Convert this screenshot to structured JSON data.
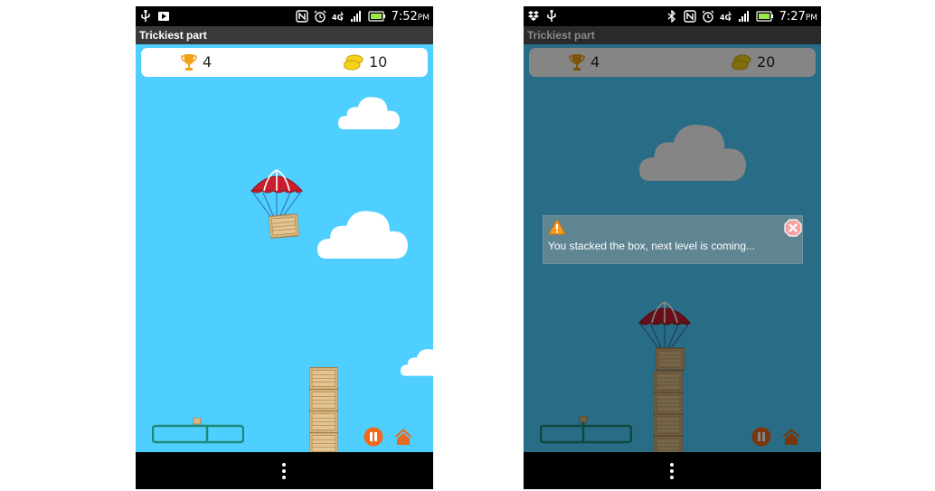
{
  "app": {
    "title": "Trickiest part"
  },
  "colors": {
    "sky": "#4fcfff",
    "cloud": "#ffffff",
    "parachute": "#c81e2e",
    "crate": "#d8b884",
    "hud_bg": "#ffffff",
    "pause_btn": "#f06a1a",
    "home_btn": "#e56a21",
    "slider": "#1d8a76",
    "dialog_bg": "#5f8492",
    "warning": "#f59a1a"
  },
  "screens": [
    {
      "status": {
        "time": "7:52",
        "ampm": "PM"
      },
      "hud": {
        "score": "4",
        "coins": "10"
      },
      "stack_count": 4,
      "game_state": "dropping"
    },
    {
      "status": {
        "time": "7:27",
        "ampm": "PM"
      },
      "hud": {
        "score": "4",
        "coins": "20"
      },
      "stack_count": 5,
      "game_state": "level-complete",
      "dialog": {
        "message": "You stacked the box, next level is coming..."
      }
    }
  ],
  "icons": {
    "hud": [
      "trophy-icon",
      "coins-icon"
    ],
    "controls": [
      "pause-icon",
      "home-icon"
    ],
    "status_left_phone1": [
      "usb-icon",
      "play-store-icon"
    ],
    "status_left_phone2": [
      "dropbox-icon",
      "usb-icon"
    ],
    "status_right": [
      "bluetooth-icon",
      "nfc-icon",
      "alarm-icon",
      "4g-icon",
      "signal-icon",
      "battery-icon"
    ],
    "dialog": [
      "warning-icon",
      "close-icon"
    ]
  }
}
